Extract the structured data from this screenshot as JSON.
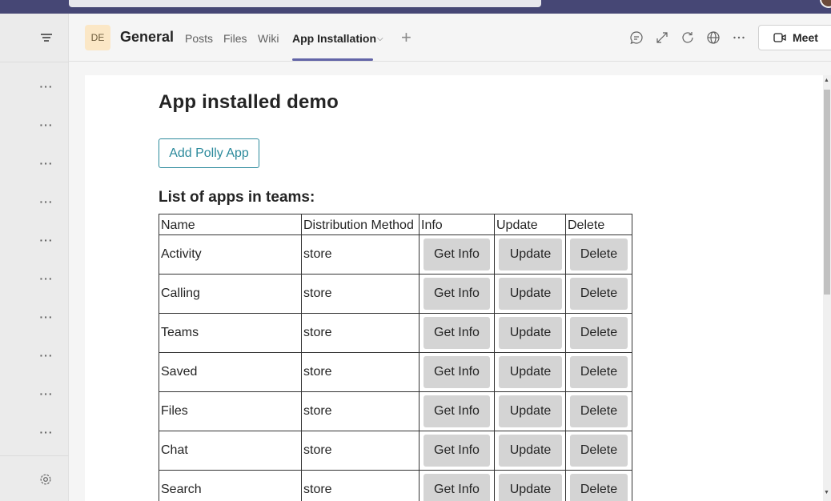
{
  "header": {
    "team_avatar": "DE",
    "channel": "General",
    "tabs": [
      {
        "label": "Posts"
      },
      {
        "label": "Files"
      },
      {
        "label": "Wiki"
      },
      {
        "label": "App Installation"
      }
    ],
    "meet_label": "Meet"
  },
  "page": {
    "title": "App installed demo",
    "add_button": "Add Polly App",
    "list_title": "List of apps in teams:"
  },
  "table": {
    "columns": [
      "Name",
      "Distribution Method",
      "Info",
      "Update",
      "Delete"
    ],
    "buttons": {
      "info": "Get Info",
      "update": "Update",
      "delete": "Delete"
    },
    "rows": [
      {
        "name": "Activity",
        "method": "store"
      },
      {
        "name": "Calling",
        "method": "store"
      },
      {
        "name": "Teams",
        "method": "store"
      },
      {
        "name": "Saved",
        "method": "store"
      },
      {
        "name": "Files",
        "method": "store"
      },
      {
        "name": "Chat",
        "method": "store"
      },
      {
        "name": "Search",
        "method": "store"
      }
    ]
  },
  "colors": {
    "accent": "#6264a7",
    "topbar": "#464775",
    "link_button": "#2c8a9c",
    "table_button": "#d4d4d4"
  }
}
